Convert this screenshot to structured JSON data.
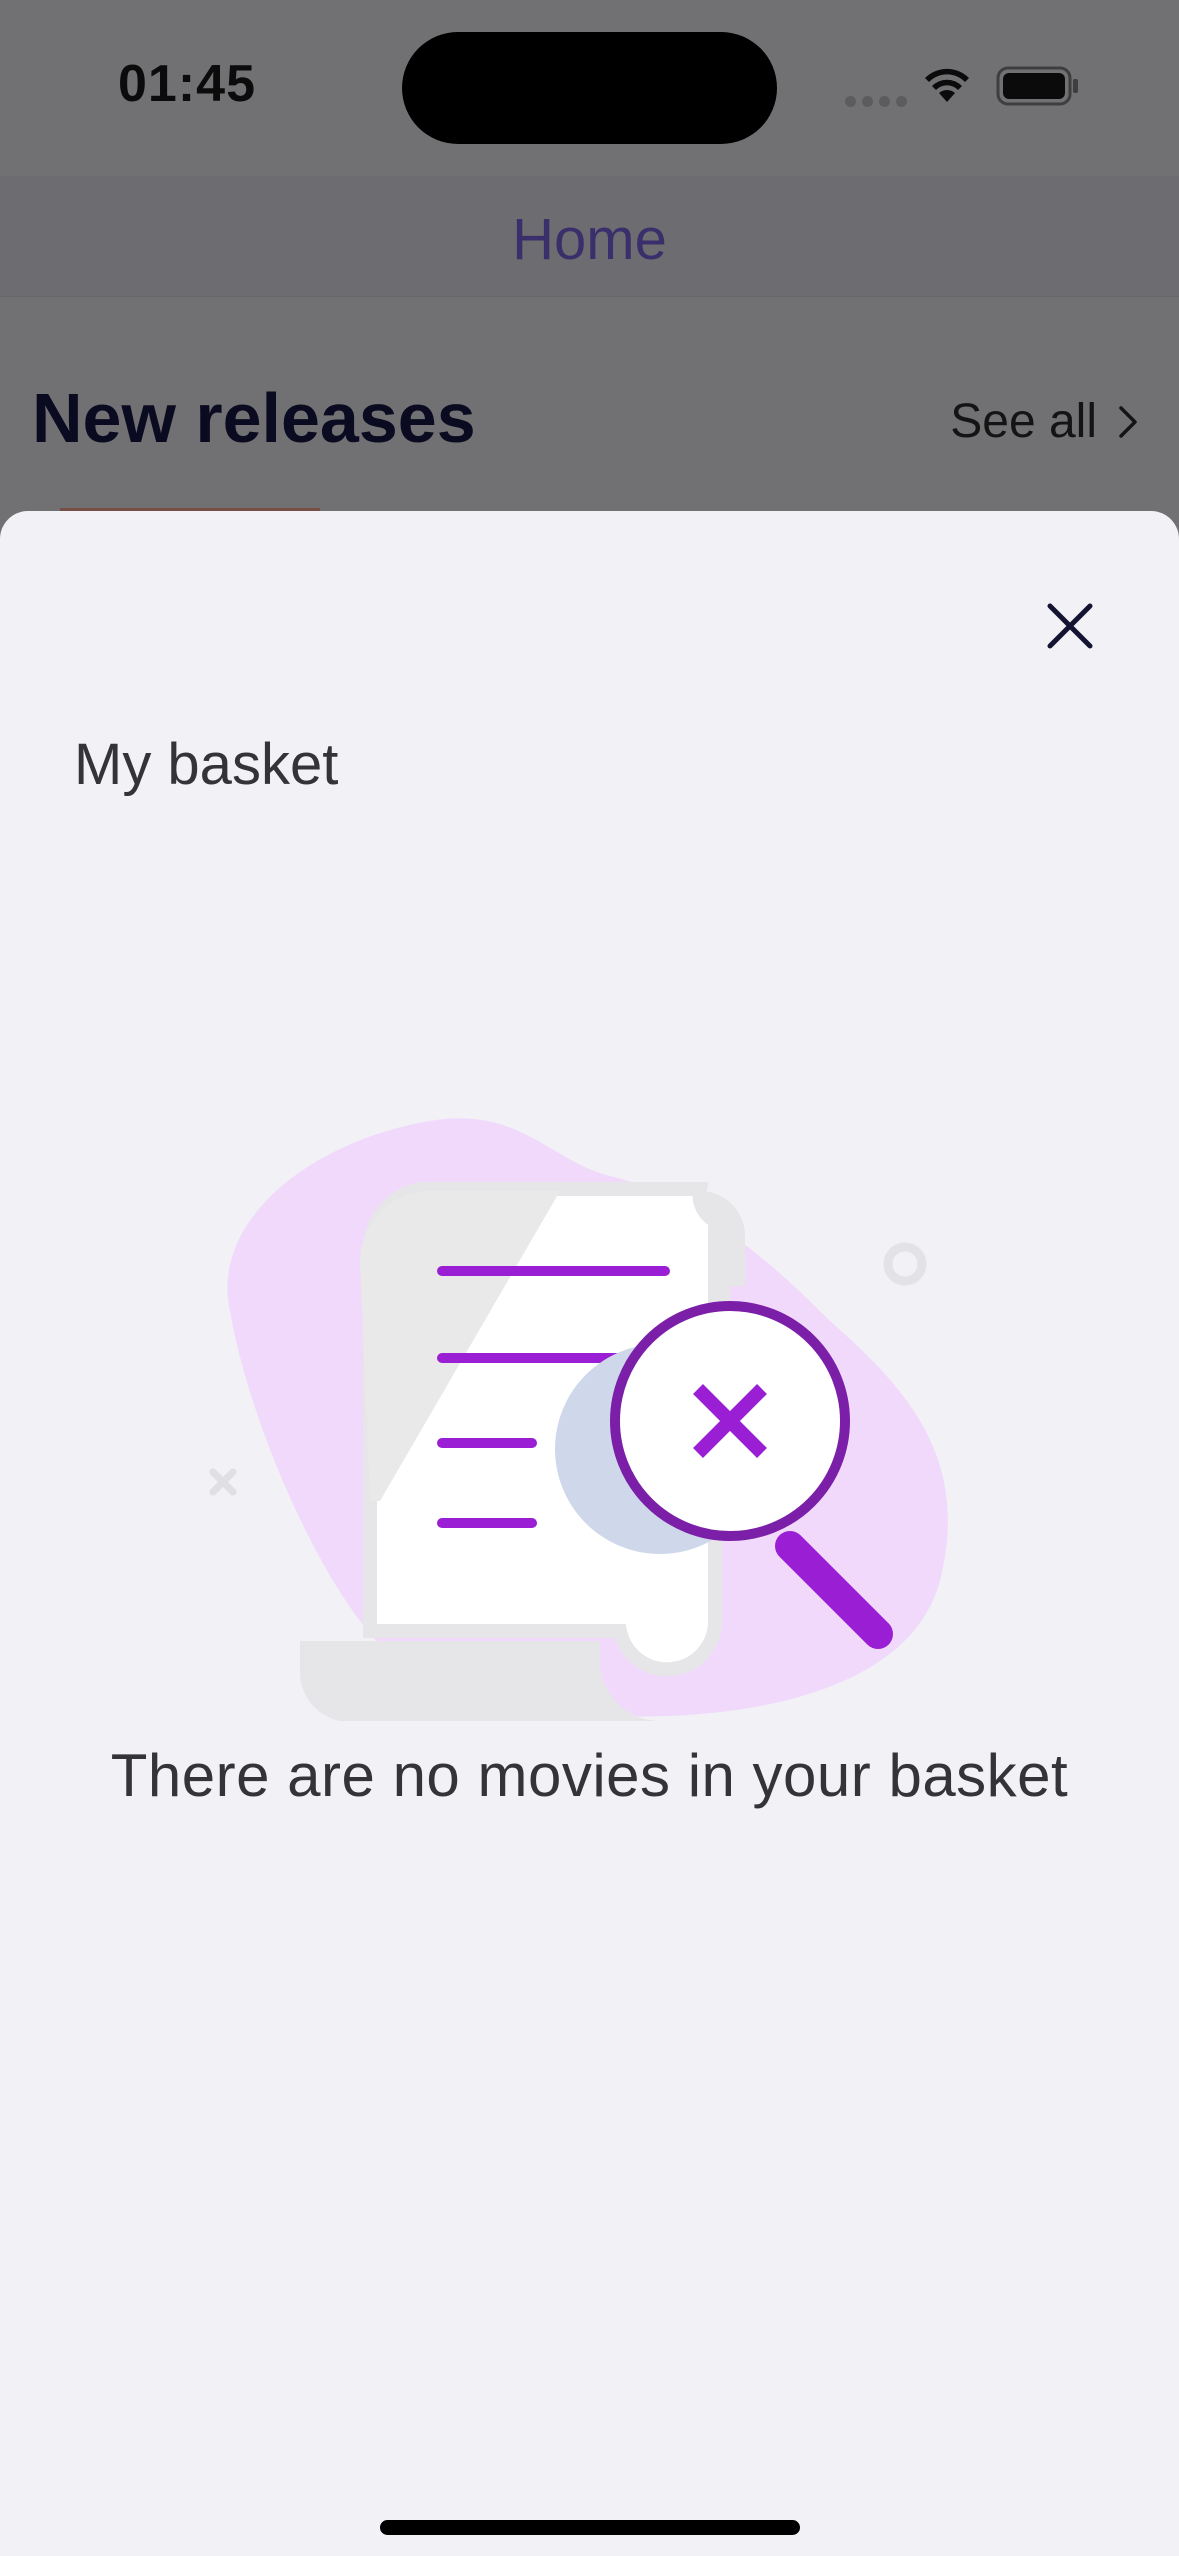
{
  "status_bar": {
    "time": "01:45"
  },
  "nav": {
    "title": "Home"
  },
  "section": {
    "title": "New releases",
    "see_all_label": "See all"
  },
  "sheet": {
    "title": "My basket",
    "empty_message": "There are no movies in your basket",
    "close_icon": "close-icon",
    "illustration_icon": "empty-basket-search-illustration"
  },
  "colors": {
    "accent": "#9a1fd4",
    "nav_title": "#3b2f6b",
    "sheet_background": "#f1f1f6",
    "blob": "#f1d9fb"
  }
}
